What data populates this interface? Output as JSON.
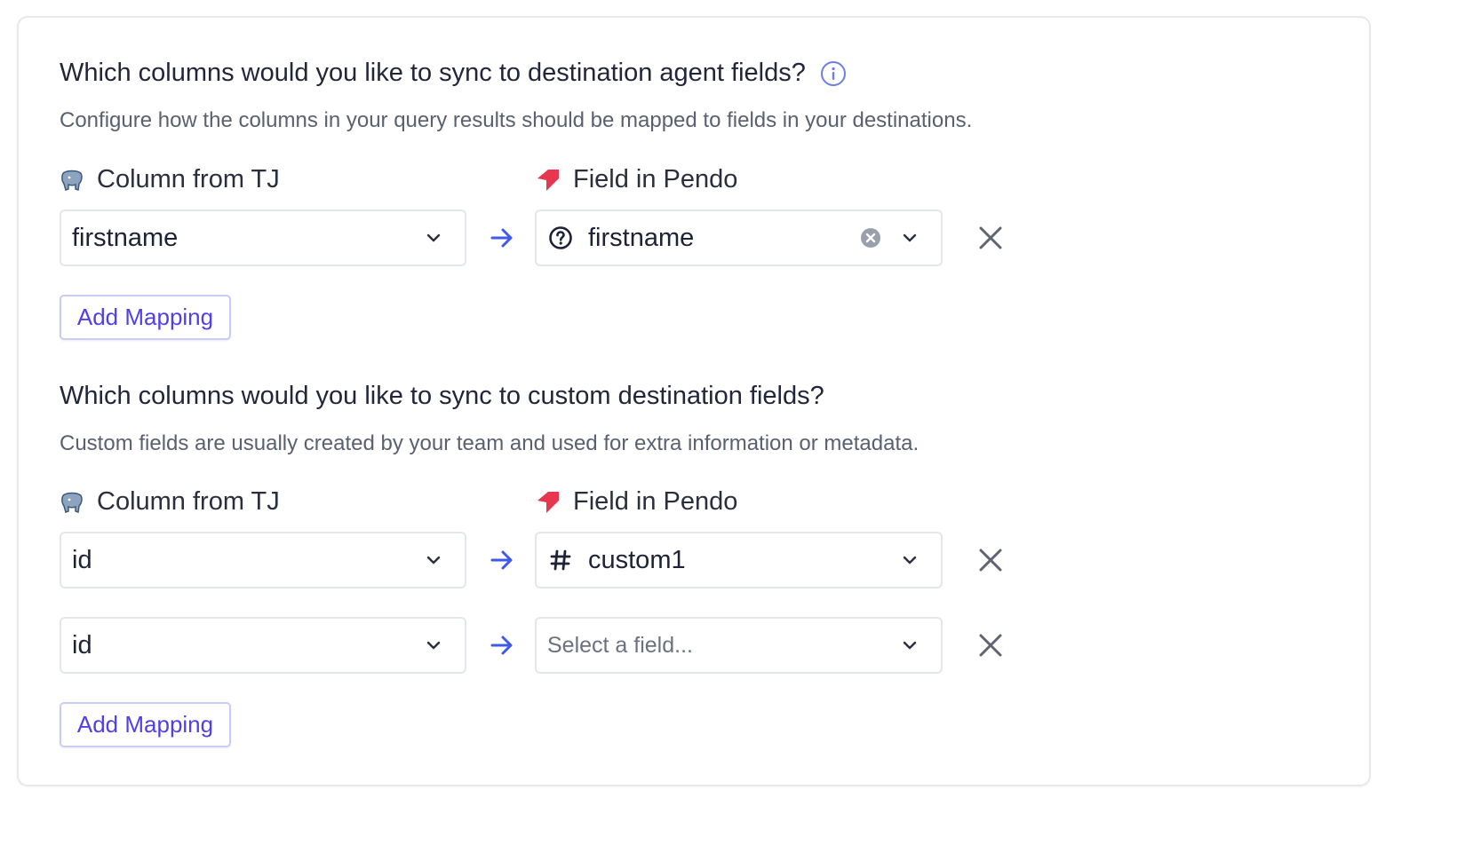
{
  "section_agent": {
    "title": "Which columns would you like to sync to destination agent fields?",
    "description": "Configure how the columns in your query results should be mapped to fields in your destinations.",
    "source_header": "Column from TJ",
    "dest_header": "Field in Pendo",
    "rows": [
      {
        "source_value": "firstname",
        "dest_value": "firstname",
        "dest_icon": "question-circle-icon"
      }
    ],
    "add_label": "Add Mapping"
  },
  "section_custom": {
    "title": "Which columns would you like to sync to custom destination fields?",
    "description": "Custom fields are usually created by your team and used for extra information or metadata.",
    "source_header": "Column from TJ",
    "dest_header": "Field in Pendo",
    "rows": [
      {
        "source_value": "id",
        "dest_value": "custom1",
        "dest_icon": "hash-icon"
      },
      {
        "source_value": "id",
        "dest_placeholder": "Select a field..."
      }
    ],
    "add_label": "Add Mapping"
  },
  "icons": {
    "info": "info-circle-icon",
    "source": "postgres-elephant-icon",
    "destination": "pendo-logo-icon"
  },
  "colors": {
    "accent": "#5040e6",
    "arrow": "#3f5ae8",
    "info": "#6b7fe6",
    "pendo": "#e8364f",
    "border": "#e3e6ec"
  }
}
